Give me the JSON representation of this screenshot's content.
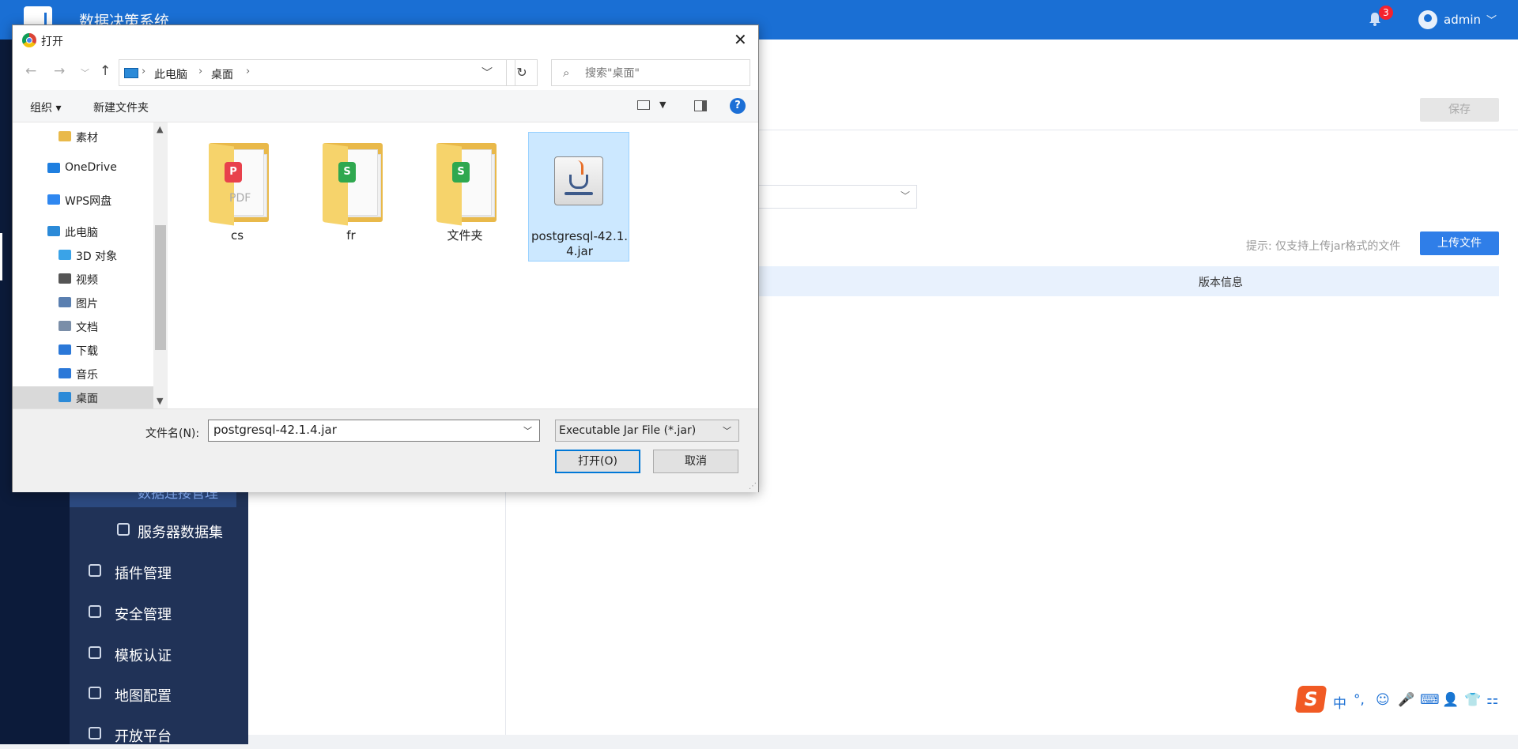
{
  "app": {
    "title": "数据决策系统",
    "notification_count": "3",
    "user": "admin"
  },
  "sidebar": {
    "active_item": "数据连接管理",
    "items": [
      {
        "label": "服务器数据集",
        "sub": true
      },
      {
        "label": "插件管理",
        "sub": false
      },
      {
        "label": "安全管理",
        "sub": false
      },
      {
        "label": "模板认证",
        "sub": false
      },
      {
        "label": "地图配置",
        "sub": false
      },
      {
        "label": "开放平台",
        "sub": false
      }
    ]
  },
  "main": {
    "save_label": "保存",
    "hint": "提示: 仅支持上传jar格式的文件",
    "upload_label": "上传文件",
    "column_header": "版本信息"
  },
  "ime": {
    "logo": "S",
    "items": [
      "中",
      "°,",
      "☺",
      "🎤",
      "⌨",
      "👤",
      "👕",
      "⚏"
    ]
  },
  "dialog": {
    "title": "打开",
    "breadcrumbs": [
      "此电脑",
      "桌面"
    ],
    "search_placeholder": "搜索\"桌面\"",
    "commands": {
      "organize": "组织 ▾",
      "new_folder": "新建文件夹"
    },
    "nav_tree": [
      {
        "label": "素材",
        "icon": "folder-icon",
        "color": "#e9b94a"
      },
      {
        "label": "OneDrive",
        "icon": "cloud-icon",
        "color": "#1f7fe0"
      },
      {
        "label": "WPS网盘",
        "icon": "cloud-icon",
        "color": "#2f87f0"
      },
      {
        "label": "此电脑",
        "icon": "computer-icon",
        "color": "#2b8ad8"
      },
      {
        "label": "3D 对象",
        "icon": "cube-icon",
        "color": "#3aa3e8"
      },
      {
        "label": "视频",
        "icon": "film-icon",
        "color": "#555555"
      },
      {
        "label": "图片",
        "icon": "picture-icon",
        "color": "#5a7fb0"
      },
      {
        "label": "文档",
        "icon": "document-icon",
        "color": "#7a8ea8"
      },
      {
        "label": "下载",
        "icon": "download-icon",
        "color": "#2b78d8"
      },
      {
        "label": "音乐",
        "icon": "music-icon",
        "color": "#2b78d8"
      },
      {
        "label": "桌面",
        "icon": "desktop-icon",
        "color": "#2b8ad8",
        "selected": true
      }
    ],
    "files": [
      {
        "name": "cs",
        "kind": "folder",
        "badge": "P",
        "badge_color": "#e8414c",
        "tag": "PDF"
      },
      {
        "name": "fr",
        "kind": "folder",
        "badge": "S",
        "badge_color": "#2fa84f",
        "tag": ""
      },
      {
        "name": "文件夹",
        "kind": "folder",
        "badge": "S",
        "badge_color": "#2fa84f",
        "tag": ""
      },
      {
        "name": "postgresql-42.1.4.jar",
        "kind": "jar",
        "selected": true
      }
    ],
    "filename_label": "文件名(N):",
    "filename_value": "postgresql-42.1.4.jar",
    "filetype": "Executable Jar File (*.jar)",
    "open_label": "打开(O)",
    "cancel_label": "取消"
  }
}
